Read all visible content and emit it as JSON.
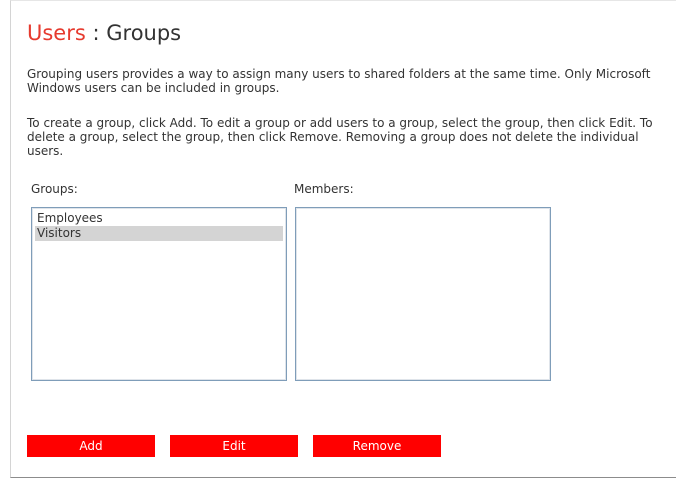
{
  "page": {
    "breadcrumb_parent": "Users",
    "separator": " : ",
    "title": "Groups"
  },
  "description": {
    "paragraph1": "Grouping users provides a way to assign many users to shared folders at the same time. Only Microsoft Windows users can be included in groups.",
    "paragraph2": "To create a group, click Add. To edit a group or add users to a group, select the group, then click Edit. To delete a group, select the group, then click Remove. Removing a group does not delete the individual users."
  },
  "groups": {
    "label": "Groups:",
    "items": [
      {
        "label": "Employees",
        "selected": false
      },
      {
        "label": "Visitors",
        "selected": true
      }
    ]
  },
  "members": {
    "label": "Members:",
    "items": []
  },
  "actions": {
    "add_label": "Add",
    "edit_label": "Edit",
    "remove_label": "Remove"
  },
  "colors": {
    "accent": "#e63a2e",
    "button_bg": "#ff0000",
    "button_text": "#ffffff",
    "selection_bg": "#d4d4d4",
    "listbox_border": "#7f9db9"
  }
}
